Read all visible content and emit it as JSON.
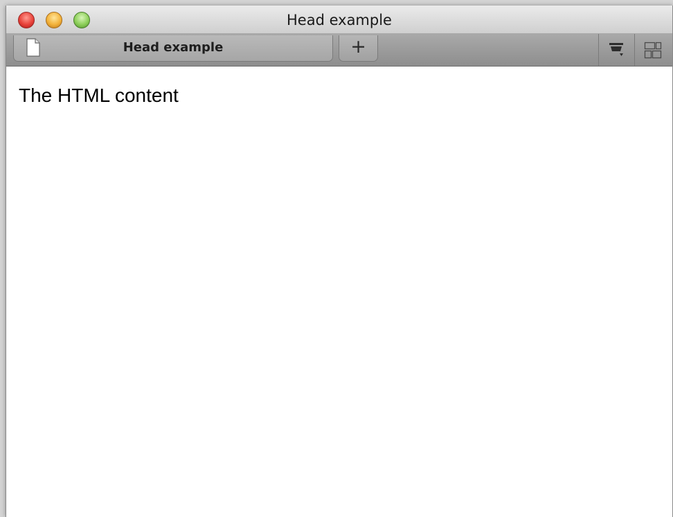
{
  "window": {
    "title": "Head example"
  },
  "tabs": [
    {
      "label": "Head example",
      "icon": "document-icon",
      "active": true
    }
  ],
  "toolbar": {
    "new_tab_label": "+",
    "buttons": [
      {
        "icon": "tab-overview-icon"
      },
      {
        "icon": "grid-view-icon"
      }
    ]
  },
  "content": {
    "text": "The HTML content"
  },
  "colors": {
    "close": "#e8423a",
    "minimize": "#f3b23a",
    "zoom": "#8dcf5a"
  }
}
